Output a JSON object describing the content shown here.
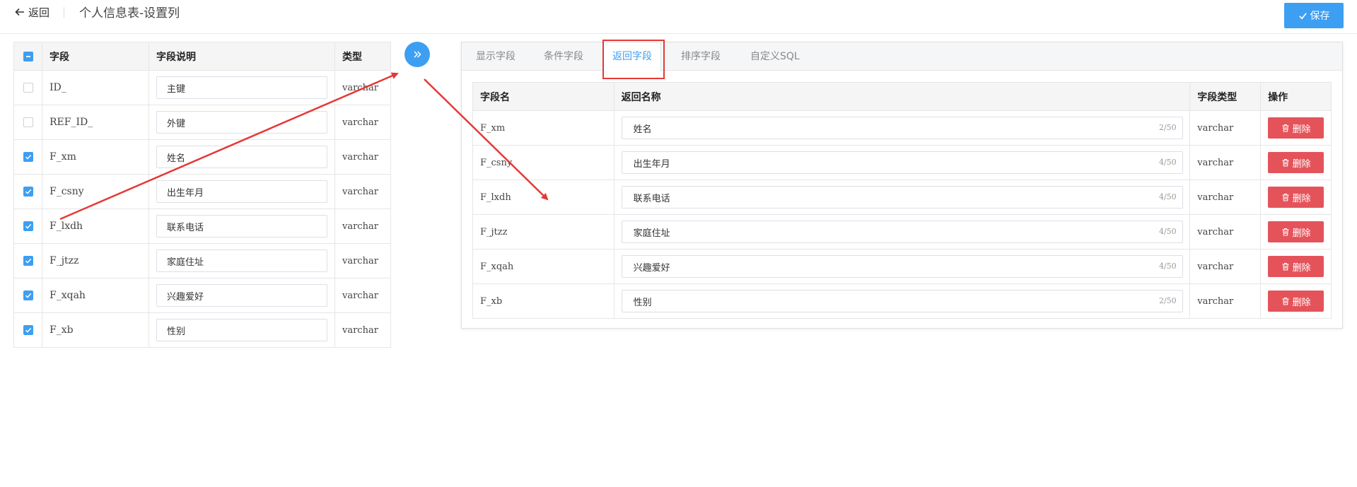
{
  "header": {
    "back_label": "返回",
    "title": "个人信息表-设置列",
    "save_label": "保存"
  },
  "left_table": {
    "headers": {
      "field": "字段",
      "description": "字段说明",
      "type": "类型"
    },
    "rows": [
      {
        "checked": false,
        "field": "ID_",
        "description": "主键",
        "type": "varchar"
      },
      {
        "checked": false,
        "field": "REF_ID_",
        "description": "外键",
        "type": "varchar"
      },
      {
        "checked": true,
        "field": "F_xm",
        "description": "姓名",
        "type": "varchar"
      },
      {
        "checked": true,
        "field": "F_csny",
        "description": "出生年月",
        "type": "varchar"
      },
      {
        "checked": true,
        "field": "F_lxdh",
        "description": "联系电话",
        "type": "varchar"
      },
      {
        "checked": true,
        "field": "F_jtzz",
        "description": "家庭住址",
        "type": "varchar"
      },
      {
        "checked": true,
        "field": "F_xqah",
        "description": "兴趣爱好",
        "type": "varchar"
      },
      {
        "checked": true,
        "field": "F_xb",
        "description": "性别",
        "type": "varchar"
      }
    ]
  },
  "tabs": [
    {
      "label": "显示字段",
      "active": false
    },
    {
      "label": "条件字段",
      "active": false
    },
    {
      "label": "返回字段",
      "active": true
    },
    {
      "label": "排序字段",
      "active": false
    },
    {
      "label": "自定义SQL",
      "active": false
    }
  ],
  "right_table": {
    "headers": {
      "field_name": "字段名",
      "return_name": "返回名称",
      "field_type": "字段类型",
      "action": "操作"
    },
    "delete_label": "删除",
    "rows": [
      {
        "field_name": "F_xm",
        "return_name": "姓名",
        "count": "2/50",
        "field_type": "varchar"
      },
      {
        "field_name": "F_csny",
        "return_name": "出生年月",
        "count": "4/50",
        "field_type": "varchar"
      },
      {
        "field_name": "F_lxdh",
        "return_name": "联系电话",
        "count": "4/50",
        "field_type": "varchar"
      },
      {
        "field_name": "F_jtzz",
        "return_name": "家庭住址",
        "count": "4/50",
        "field_type": "varchar"
      },
      {
        "field_name": "F_xqah",
        "return_name": "兴趣爱好",
        "count": "4/50",
        "field_type": "varchar"
      },
      {
        "field_name": "F_xb",
        "return_name": "性别",
        "count": "2/50",
        "field_type": "varchar"
      }
    ]
  },
  "colors": {
    "accent": "#3d9ff2",
    "danger": "#e5535a",
    "annotation": "#e53935"
  }
}
